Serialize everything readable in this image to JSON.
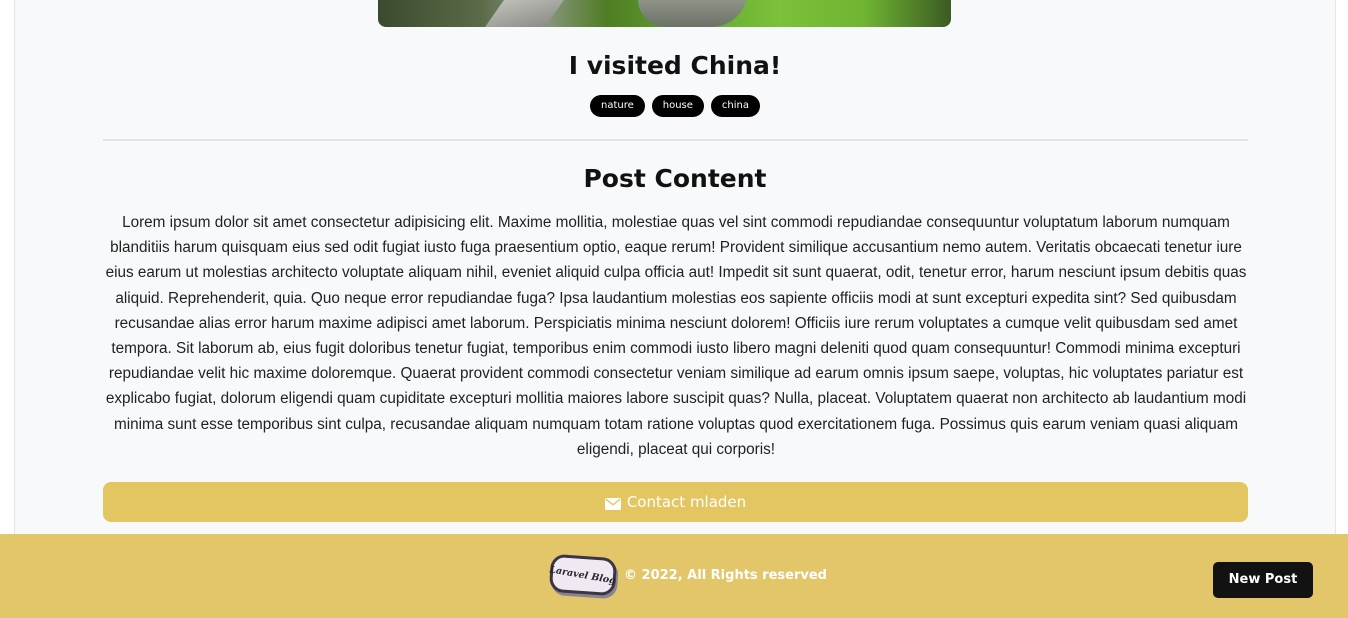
{
  "post": {
    "title": "I visited China!",
    "tags": [
      "nature",
      "house",
      "china"
    ],
    "content_heading": "Post Content",
    "content": "Lorem ipsum dolor sit amet consectetur adipisicing elit. Maxime mollitia, molestiae quas vel sint commodi repudiandae consequuntur voluptatum laborum numquam blanditiis harum quisquam eius sed odit fugiat iusto fuga praesentium optio, eaque rerum! Provident similique accusantium nemo autem. Veritatis obcaecati tenetur iure eius earum ut molestias architecto voluptate aliquam nihil, eveniet aliquid culpa officia aut! Impedit sit sunt quaerat, odit, tenetur error, harum nesciunt ipsum debitis quas aliquid. Reprehenderit, quia. Quo neque error repudiandae fuga? Ipsa laudantium molestias eos sapiente officiis modi at sunt excepturi expedita sint? Sed quibusdam recusandae alias error harum maxime adipisci amet laborum. Perspiciatis minima nesciunt dolorem! Officiis iure rerum voluptates a cumque velit quibusdam sed amet tempora. Sit laborum ab, eius fugit doloribus tenetur fugiat, temporibus enim commodi iusto libero magni deleniti quod quam consequuntur! Commodi minima excepturi repudiandae velit hic maxime doloremque. Quaerat provident commodi consectetur veniam similique ad earum omnis ipsum saepe, voluptas, hic voluptates pariatur est explicabo fugiat, dolorum eligendi quam cupiditate excepturi mollitia maiores labore suscipit quas? Nulla, placeat. Voluptatem quaerat non architecto ab laudantium modi minima sunt esse temporibus sint culpa, recusandae aliquam numquam totam ratione voluptas quod exercitationem fuga. Possimus quis earum veniam quasi aliquam eligendi, placeat qui corporis!",
    "contact_label": "Contact mladen",
    "contact_icon": "envelope-icon"
  },
  "footer": {
    "logo_text": "Laravel Blog",
    "copyright": "© 2022, All Rights reserved",
    "new_post_label": "New Post"
  },
  "colors": {
    "accent": "#e3c562",
    "footer_bg": "#e3c66a",
    "tag_bg": "#000000",
    "new_post_bg": "#121212"
  }
}
